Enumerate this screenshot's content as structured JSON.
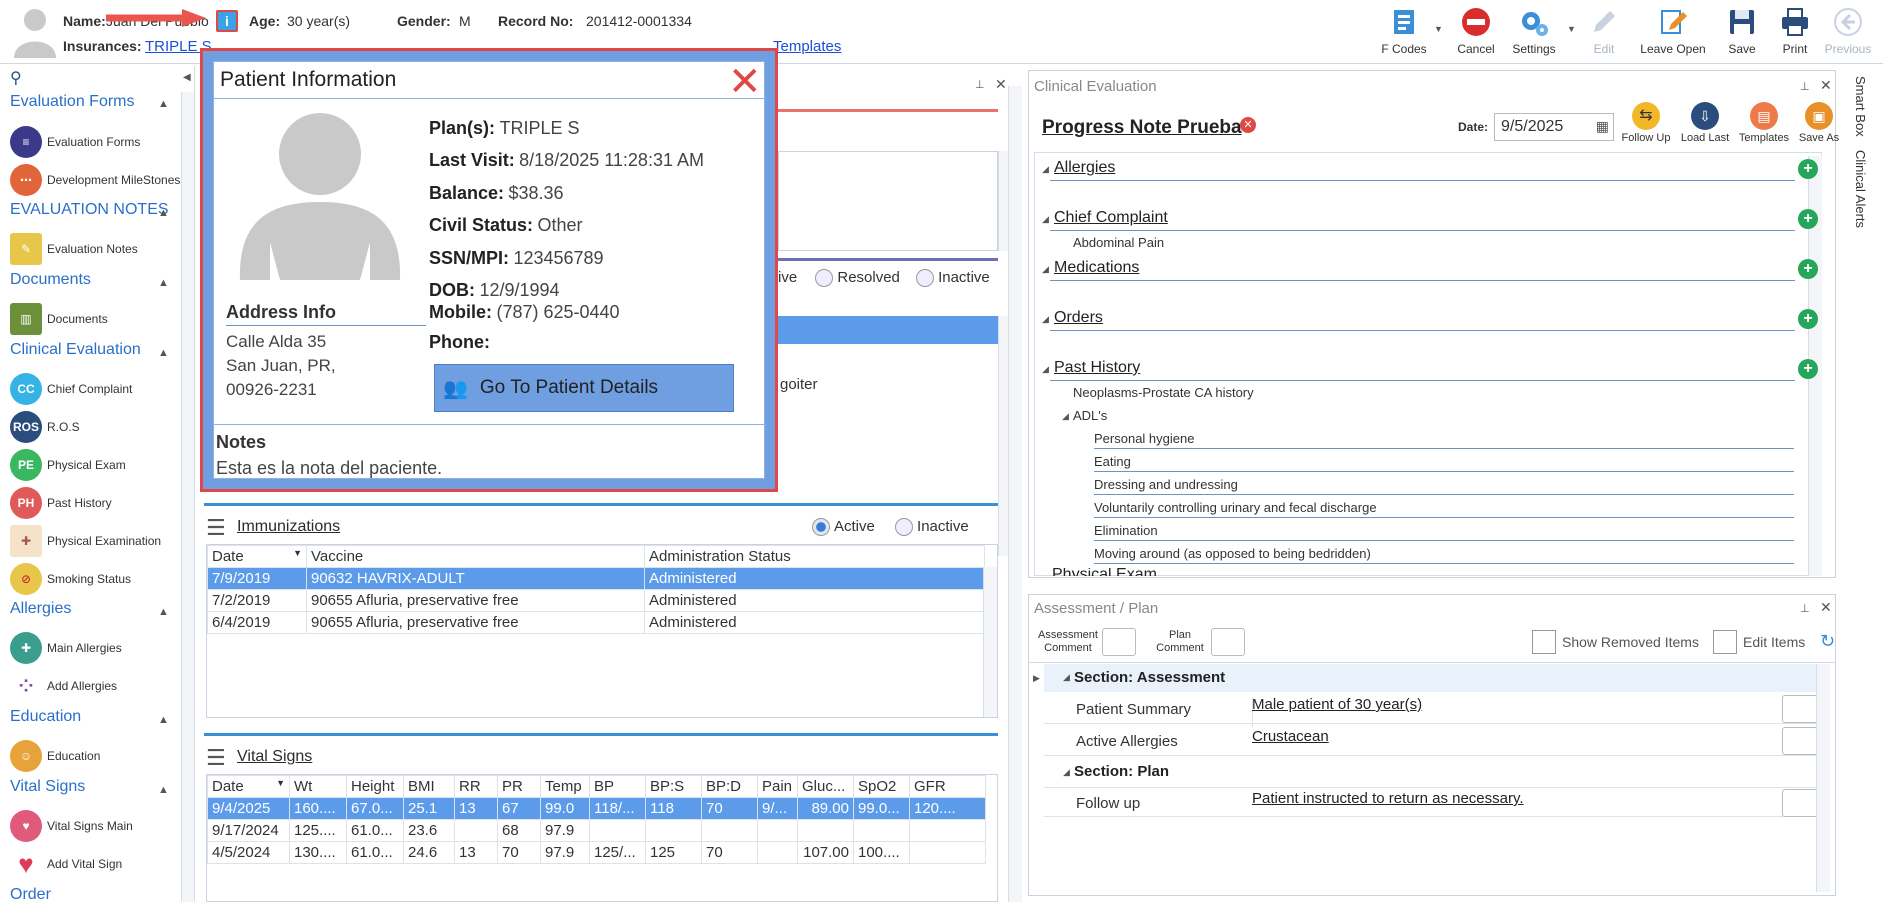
{
  "header": {
    "name_label": "Name:",
    "name_value": "Juan Del Pueblo",
    "age_label": "Age:",
    "age_value": "30 year(s)",
    "gender_label": "Gender:",
    "gender_value": "M",
    "record_label": "Record No:",
    "record_value": "201412-0001334",
    "insurances_label": "Insurances:",
    "insurances_value": "TRIPLE S",
    "tail_link": "Templates"
  },
  "toolbar": {
    "fcodes": "F Codes",
    "cancel": "Cancel",
    "settings": "Settings",
    "edit": "Edit",
    "leave_open": "Leave Open",
    "save": "Save",
    "print": "Print",
    "previous": "Previous"
  },
  "nav": {
    "sections": [
      {
        "title": "Evaluation Forms",
        "items": [
          "Evaluation Forms",
          "Development MileStones"
        ]
      },
      {
        "title": "EVALUATION NOTES",
        "items": [
          "Evaluation Notes"
        ]
      },
      {
        "title": "Documents",
        "items": [
          "Documents"
        ]
      },
      {
        "title": "Clinical Evaluation",
        "items": [
          "Chief Complaint",
          "R.O.S",
          "Physical Exam",
          "Past History",
          "Physical Examination",
          "Smoking Status"
        ]
      },
      {
        "title": "Allergies",
        "items": [
          "Main Allergies",
          "Add Allergies"
        ]
      },
      {
        "title": "Education",
        "items": [
          "Education"
        ]
      },
      {
        "title": "Vital Signs",
        "items": [
          "Vital Signs Main",
          "Add Vital Sign"
        ]
      },
      {
        "title": "Order",
        "items": []
      }
    ],
    "icon_text": {
      "cc": "CC",
      "ros": "ROS",
      "pe": "PE",
      "ph": "PH"
    }
  },
  "popup": {
    "title": "Patient Information",
    "plans_label": "Plan(s):",
    "plans_value": "TRIPLE S",
    "last_visit_label": "Last Visit:",
    "last_visit_value": "8/18/2025 11:28:31 AM",
    "balance_label": "Balance:",
    "balance_value": "$38.36",
    "civil_label": "Civil Status:",
    "civil_value": "Other",
    "ssn_label": "SSN/MPI:",
    "ssn_value": "123456789",
    "dob_label": "DOB:",
    "dob_value": "12/9/1994",
    "mobile_label": "Mobile:",
    "mobile_value": "(787) 625-0440",
    "phone_label": "Phone:",
    "phone_value": "",
    "address_title": "Address Info",
    "address_line1": "Calle Alda 35",
    "address_line2": "San Juan, PR,",
    "address_line3": "00926-2231",
    "details_button": "Go To Patient Details",
    "notes_title": "Notes",
    "notes_value": "Esta es la nota del paciente."
  },
  "problems": {
    "radio_active_partial": "ive",
    "radio_resolved": "Resolved",
    "radio_inactive": "Inactive",
    "cell_text": "goiter"
  },
  "immunizations": {
    "title": "Immunizations",
    "radio_active": "Active",
    "radio_inactive": "Inactive",
    "columns": [
      "Date",
      "Vaccine",
      "Administration Status"
    ],
    "rows": [
      [
        "7/9/2019",
        "90632 HAVRIX-ADULT",
        "Administered"
      ],
      [
        "7/2/2019",
        "90655 Afluria, preservative free",
        "Administered"
      ],
      [
        "6/4/2019",
        "90655 Afluria, preservative free",
        "Administered"
      ]
    ]
  },
  "vitals": {
    "title": "Vital Signs",
    "columns": [
      "Date",
      "Wt",
      "Height",
      "BMI",
      "RR",
      "PR",
      "Temp",
      "BP",
      "BP:S",
      "BP:D",
      "Pain",
      "Gluc...",
      "SpO2",
      "GFR"
    ],
    "rows": [
      [
        "9/4/2025",
        "160....",
        "67.0...",
        "25.1",
        "13",
        "67",
        "99.0",
        "118/...",
        "118",
        "70",
        "9/...",
        "89.00",
        "99.0...",
        "120...."
      ],
      [
        "9/17/2024",
        "125....",
        "61.0...",
        "23.6",
        "",
        "68",
        "97.9",
        "",
        "",
        "",
        "",
        "",
        "",
        ""
      ],
      [
        "4/5/2024",
        "130....",
        "61.0...",
        "24.6",
        "13",
        "70",
        "97.9",
        "125/...",
        "125",
        "70",
        "",
        "107.00",
        "100....",
        ""
      ]
    ]
  },
  "clinical": {
    "panel_title": "Clinical Evaluation",
    "note_title": "Progress Note Prueba",
    "date_label": "Date:",
    "date_value": "9/5/2025",
    "btn_follow": "Follow Up",
    "btn_load": "Load Last",
    "btn_templates": "Templates",
    "btn_saveas": "Save As",
    "sections": {
      "allergies": "Allergies",
      "chief": "Chief Complaint",
      "chief_item": "Abdominal Pain",
      "medications": "Medications",
      "orders": "Orders",
      "past": "Past History",
      "past_item": "Neoplasms-Prostate CA history",
      "adls": "ADL's",
      "adl_items": [
        "Personal hygiene",
        "Eating",
        "Dressing and undressing",
        "Voluntarily controlling urinary and fecal discharge",
        "Elimination",
        "Moving around (as opposed to being bedridden)"
      ],
      "physical": "Physical Exam"
    },
    "side_tabs": [
      "Smart Box",
      "Clinical Alerts"
    ]
  },
  "assessment": {
    "panel_title": "Assessment / Plan",
    "comment_label": "Assessment Comment",
    "plan_label": "Plan Comment",
    "show_removed": "Show Removed Items",
    "edit_items": "Edit Items",
    "section_assessment": "Section: Assessment",
    "patient_summary_label": "Patient Summary",
    "patient_summary_value": "Male patient of 30 year(s)",
    "active_allergies_label": "Active Allergies",
    "active_allergies_value": "Crustacean",
    "section_plan": "Section: Plan",
    "follow_label": "Follow up",
    "follow_value": "Patient instructed to return as necessary."
  },
  "colors": {
    "accent": "#2a6fc9",
    "popup_border": "#e04848",
    "selection": "#5b9bea",
    "add_green": "#26a65b"
  }
}
